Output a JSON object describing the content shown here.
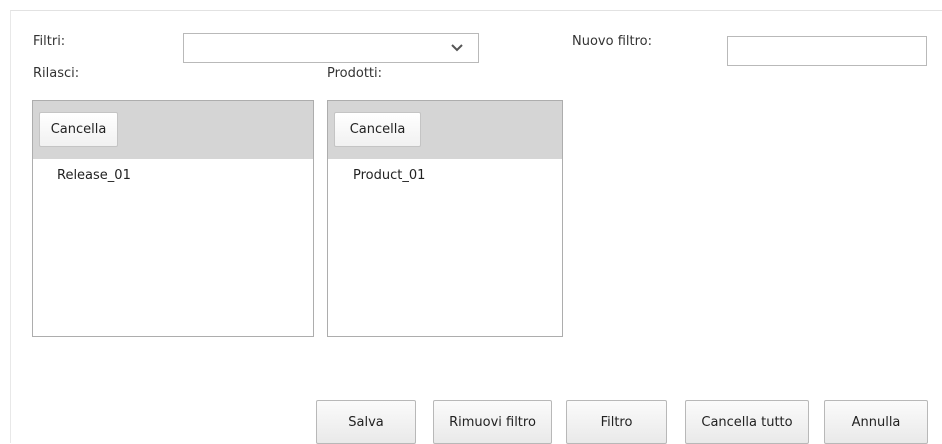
{
  "filters": {
    "label": "Filtri:",
    "selected_value": ""
  },
  "new_filter": {
    "label": "Nuovo filtro:",
    "value": ""
  },
  "releases": {
    "label": "Rilasci:",
    "clear_button": "Cancella",
    "items": [
      "Release_01"
    ]
  },
  "products": {
    "label": "Prodotti:",
    "clear_button": "Cancella",
    "items": [
      "Product_01"
    ]
  },
  "footer": {
    "save": "Salva",
    "remove_filter": "Rimuovi filtro",
    "filter": "Filtro",
    "clear_all": "Cancella tutto",
    "cancel": "Annulla"
  }
}
